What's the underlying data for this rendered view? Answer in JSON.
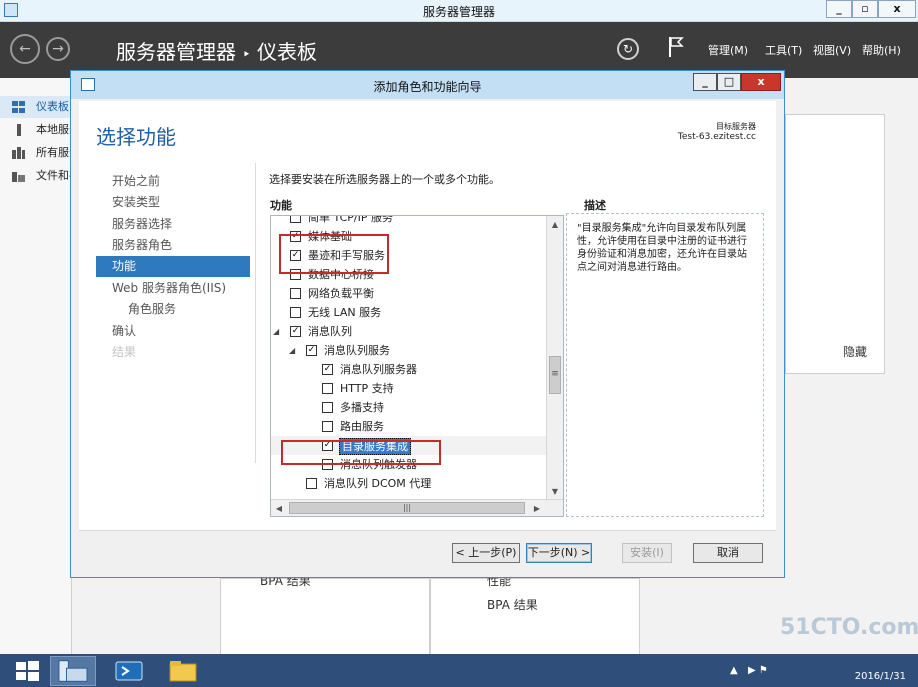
{
  "window": {
    "title": "服务器管理器",
    "btn_min": "_",
    "btn_max": "▫",
    "btn_close": "x"
  },
  "toolbar": {
    "breadcrumb_app": "服务器管理器",
    "breadcrumb_sep": "‣",
    "breadcrumb_page": "仪表板",
    "back": "←",
    "forward": "→",
    "refresh": "↻",
    "menus": [
      "管理(M)",
      "工具(T)",
      "视图(V)",
      "帮助(H)"
    ]
  },
  "sidebar": {
    "items": [
      "仪表板",
      "本地服务器",
      "所有服务器",
      "文件和存储服务"
    ]
  },
  "background": {
    "bpa_left": "BPA 结果",
    "perf_right": "性能",
    "bpa_right": "BPA 结果",
    "hide": "隐藏"
  },
  "dialog": {
    "title": "添加角色和功能向导",
    "btn_min": "_",
    "btn_max": "□",
    "btn_close": "x",
    "page_title": "选择功能",
    "target_label": "目标服务器",
    "target_server": "Test-63.ezitest.cc",
    "steps": [
      "开始之前",
      "安装类型",
      "服务器选择",
      "服务器角色",
      "功能",
      "Web 服务器角色(IIS)",
      "角色服务",
      "确认",
      "结果"
    ],
    "instruction": "选择要安装在所选服务器上的一个或多个功能。",
    "features_header": "功能",
    "description_header": "描述",
    "features": [
      {
        "label": "简单 TCP/IP 服务"
      },
      {
        "label": "媒体基础",
        "checked": true
      },
      {
        "label": "墨迹和手写服务",
        "checked": true
      },
      {
        "label": "数据中心桥接"
      },
      {
        "label": "网络负载平衡"
      },
      {
        "label": "无线 LAN 服务"
      },
      {
        "label": "消息队列",
        "checked": true,
        "expander": "◢"
      },
      {
        "label": "消息队列服务",
        "checked": true,
        "expander": "◢"
      },
      {
        "label": "消息队列服务器",
        "checked": true
      },
      {
        "label": "HTTP 支持"
      },
      {
        "label": "多播支持"
      },
      {
        "label": "路由服务"
      },
      {
        "label": "目录服务集成",
        "checked": true
      },
      {
        "label": "消息队列触发器"
      },
      {
        "label": "消息队列 DCOM 代理"
      }
    ],
    "description": "\"目录服务集成\"允许向目录发布队列属性，允许使用在目录中注册的证书进行身份验证和消息加密，还允许在目录站点之间对消息进行路由。",
    "check_mark": "✓",
    "scroll_up": "▲",
    "scroll_down": "▼",
    "scroll_left": "◀",
    "scroll_right": "▶",
    "thumb_grip": "≡",
    "hthumb_grip": "|||",
    "buttons": {
      "prev": "< 上一步(P)",
      "next": "下一步(N) >",
      "install": "安装(I)",
      "cancel": "取消"
    }
  },
  "taskbar": {
    "tray_arrow": "▲",
    "tray_icons": "▶ ⚑",
    "date": "2016/1/31"
  },
  "watermark": "51CTO.com"
}
